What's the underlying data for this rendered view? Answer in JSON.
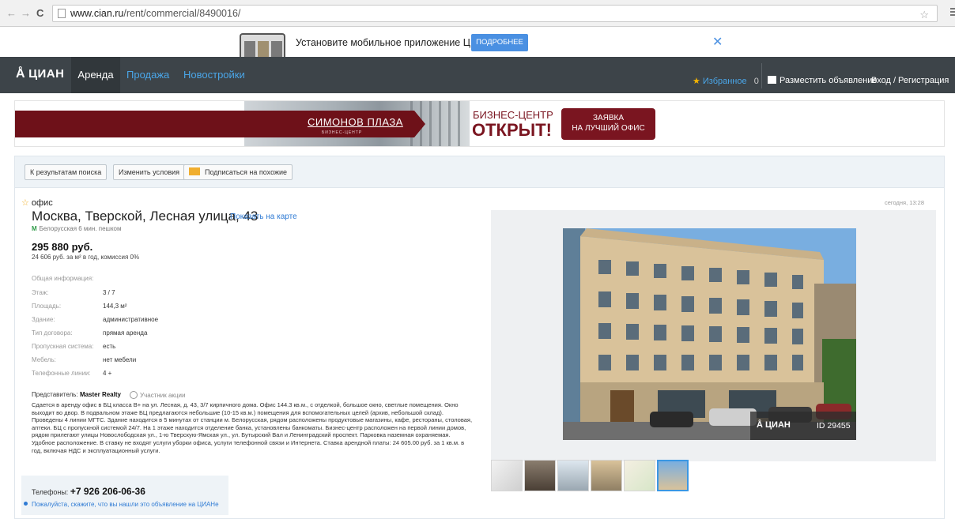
{
  "browser": {
    "url_domain": "www.cian.ru",
    "url_path": "/rent/commercial/8490016/"
  },
  "app_promo": {
    "text": "Установите мобильное приложение ЦИАН",
    "button": "ПОДРОБНЕЕ",
    "close": "✕"
  },
  "header": {
    "logo": "ЦИАН",
    "nav": [
      "Аренда",
      "Продажа",
      "Новостройки"
    ],
    "favorites_label": "Избранное",
    "favorites_count": "0",
    "post_ad": "Разместить объявление",
    "login": "Вход / Регистрация"
  },
  "banner": {
    "name": "СИМОНОВ ПЛАЗА",
    "sub": "БИЗНЕС-ЦЕНТР",
    "headline_1": "БИЗНЕС-ЦЕНТР",
    "headline_2": "ОТКРЫТ!",
    "cta_line1": "ЗАЯВКА",
    "cta_line2": "НА ЛУЧШИЙ ОФИС"
  },
  "toolbar": {
    "back": "К результатам поиска",
    "change": "Изменить условия",
    "subscribe": "Подписаться на похожие"
  },
  "listing": {
    "type": "офис",
    "address": "Москва, Тверской, Лесная улица, 43",
    "show_on_map": "Показать на карте",
    "metro": "Белорусская 6 мин. пешком",
    "price": "295 880 руб.",
    "price_detail": "24 606 руб. за м² в год, комиссия 0%",
    "date": "сегодня, 13:28",
    "info_header": "Общая информация:",
    "details": [
      {
        "label": "Этаж:",
        "value": "3 / 7"
      },
      {
        "label": "Площадь:",
        "value": "144,3 м²"
      },
      {
        "label": "Здание:",
        "value": "административное"
      },
      {
        "label": "Тип договора:",
        "value": "прямая аренда"
      },
      {
        "label": "Пропускная система:",
        "value": "есть"
      },
      {
        "label": "Мебель:",
        "value": "нет мебели"
      },
      {
        "label": "Телефонные линии:",
        "value": "4 +"
      }
    ],
    "rep_label": "Представитель:",
    "rep_name": "Master Realty",
    "promo_member": "Участник акции",
    "description": "Сдается в аренду офис в БЦ класса В+ на ул. Лесная, д. 43, 3/7 кирпичного дома. Офис 144.3 кв.м., с отделкой, большое окно, светлые помещения. Окно выходит во двор. В подвальном этаже БЦ предлагаются небольшие (10-15 кв.м.) помещения для вспомогательных целей (архив, небольшой склад). Проведены 4 линии МГТС. Здание находится в 5 минутах от станции м. Белорусская, рядом расположены продуктовые магазины, кафе, рестораны, столовая, аптеки. БЦ с пропускной системой 24/7. На 1 этаже находится отделение банка, установлены банкоматы. Бизнес-центр расположен на первой линии домов, рядом прилегают улицы Новослободская ул., 1-ю Тверскую-Ямская ул., ул. Бутырский Вал и Ленинградский проспект. Парковка наземная охраняемая. Удобное расположение. В ставку не входят услуги уборки офиса, услуги телефонной связи и Интернета. Ставка арендной платы: 24 605.00 руб. за 1 кв.м. в год, включая НДС и эксплуатационный услуги.",
    "phones_label": "Телефоны:",
    "phone": "+7 926 206-06-36",
    "ask_text": "Пожалуйста, скажите, что вы нашли это объявление на ЦИАНе"
  },
  "photo": {
    "watermark": "ЦИАН",
    "id_label": "ID 29455",
    "thumbnail_count": 6,
    "selected_thumbnail": 6
  },
  "colors": {
    "header_bg": "#3d4449",
    "link_blue": "#2f7bd4",
    "banner_red": "#6e1119",
    "accent_button": "#4a90e2"
  }
}
